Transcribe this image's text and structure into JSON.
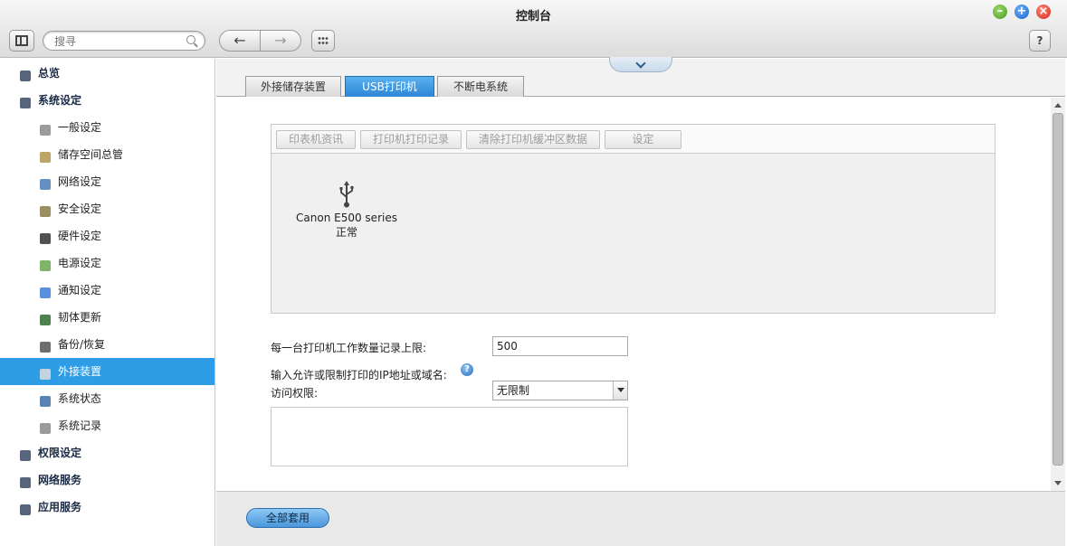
{
  "window": {
    "title": "控制台",
    "buttons": [
      "minimize-icon",
      "maximize-icon",
      "close-icon"
    ]
  },
  "toolbar": {
    "search_placeholder": "搜寻",
    "back_icon": "←",
    "forward_icon": "→",
    "help_label": "?"
  },
  "sidebar": {
    "items": [
      {
        "label": "总览",
        "level": "top",
        "icon": "overview-icon"
      },
      {
        "label": "系统设定",
        "level": "top",
        "icon": "gear-icon"
      },
      {
        "label": "一般设定",
        "level": "sub",
        "icon": "general-settings-icon"
      },
      {
        "label": "储存空间总管",
        "level": "sub",
        "icon": "storage-icon"
      },
      {
        "label": "网络设定",
        "level": "sub",
        "icon": "network-icon"
      },
      {
        "label": "安全设定",
        "level": "sub",
        "icon": "lock-icon"
      },
      {
        "label": "硬件设定",
        "level": "sub",
        "icon": "hardware-icon"
      },
      {
        "label": "电源设定",
        "level": "sub",
        "icon": "power-icon"
      },
      {
        "label": "通知设定",
        "level": "sub",
        "icon": "notification-icon"
      },
      {
        "label": "韧体更新",
        "level": "sub",
        "icon": "firmware-icon"
      },
      {
        "label": "备份/恢复",
        "level": "sub",
        "icon": "backup-icon"
      },
      {
        "label": "外接装置",
        "level": "sub",
        "icon": "external-device-icon",
        "active": true
      },
      {
        "label": "系统状态",
        "level": "sub",
        "icon": "monitor-icon"
      },
      {
        "label": "系统记录",
        "level": "sub",
        "icon": "log-icon"
      },
      {
        "label": "权限设定",
        "level": "top",
        "icon": "user-icon"
      },
      {
        "label": "网络服务",
        "level": "top",
        "icon": "globe-icon"
      },
      {
        "label": "应用服务",
        "level": "top",
        "icon": "app-service-icon"
      }
    ]
  },
  "tabs": [
    {
      "label": "外接储存装置"
    },
    {
      "label": "USB打印机",
      "active": true
    },
    {
      "label": "不断电系统"
    }
  ],
  "printer_panel": {
    "buttons": [
      "印表机资讯",
      "打印机打印记录",
      "清除打印机缓冲区数据",
      "设定"
    ],
    "printer": {
      "name": "Canon E500 series",
      "status": "正常",
      "icon": "usb-icon"
    }
  },
  "form": {
    "job_limit_label": "每一台打印机工作数量记录上限:",
    "job_limit_value": "500",
    "ip_label": "输入允许或限制打印的IP地址或域名:",
    "access_label": "访问权限:",
    "access_value": "无限制",
    "ip_list_value": ""
  },
  "footer": {
    "apply_label": "全部套用"
  },
  "colors": {
    "active_item": "#2f9de6",
    "active_tab": "#2d86d6",
    "close": "#d3261a",
    "minimize": "#4a9a1e",
    "maximize": "#1b5fc4"
  }
}
